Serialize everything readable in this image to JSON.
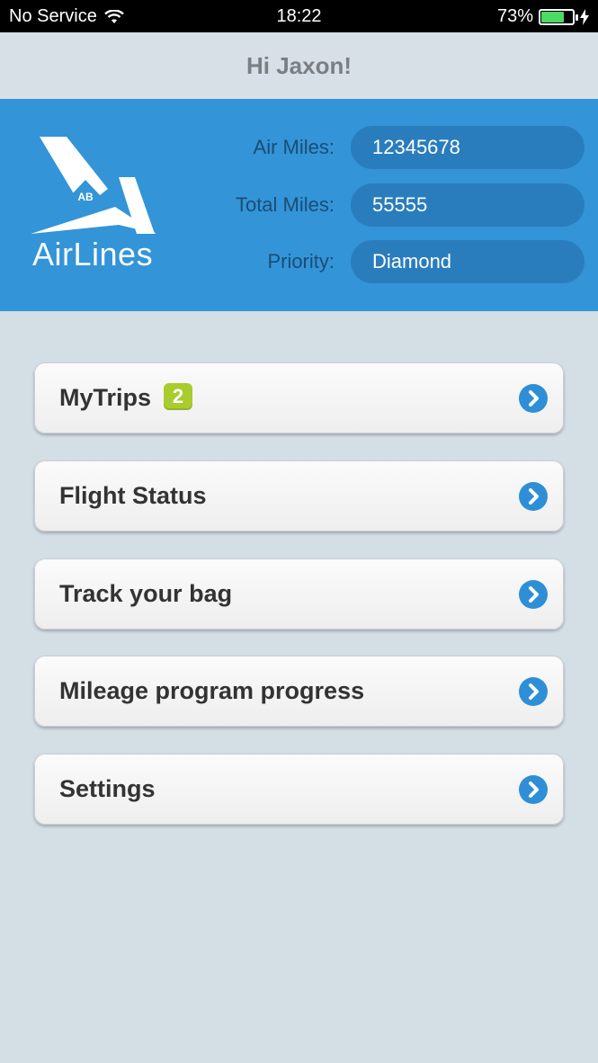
{
  "status_bar": {
    "carrier": "No Service",
    "time": "18:22",
    "battery": "73%",
    "battery_level": 0.73,
    "battery_color": "#4cd964"
  },
  "header": {
    "title": "Hi Jaxon!"
  },
  "hero": {
    "logo": {
      "word_light": "Air",
      "word_bold": "Lines",
      "monogram": "AB"
    },
    "fields": [
      {
        "label": "Air Miles:",
        "value": "12345678"
      },
      {
        "label": "Total Miles:",
        "value": "55555"
      },
      {
        "label": "Priority:",
        "value": "Diamond"
      }
    ]
  },
  "menu": [
    {
      "label": "MyTrips",
      "badge": "2",
      "icon": "chevron-right-circle-icon"
    },
    {
      "label": "Flight Status",
      "icon": "chevron-right-circle-icon"
    },
    {
      "label": "Track your bag",
      "icon": "chevron-right-circle-icon"
    },
    {
      "label": "Mileage program progress",
      "icon": "chevron-right-circle-icon"
    },
    {
      "label": "Settings",
      "icon": "chevron-right-circle-icon"
    }
  ],
  "colors": {
    "accent": "#3394d8",
    "badge": "#a9cc2f",
    "background": "#d4dee5"
  }
}
